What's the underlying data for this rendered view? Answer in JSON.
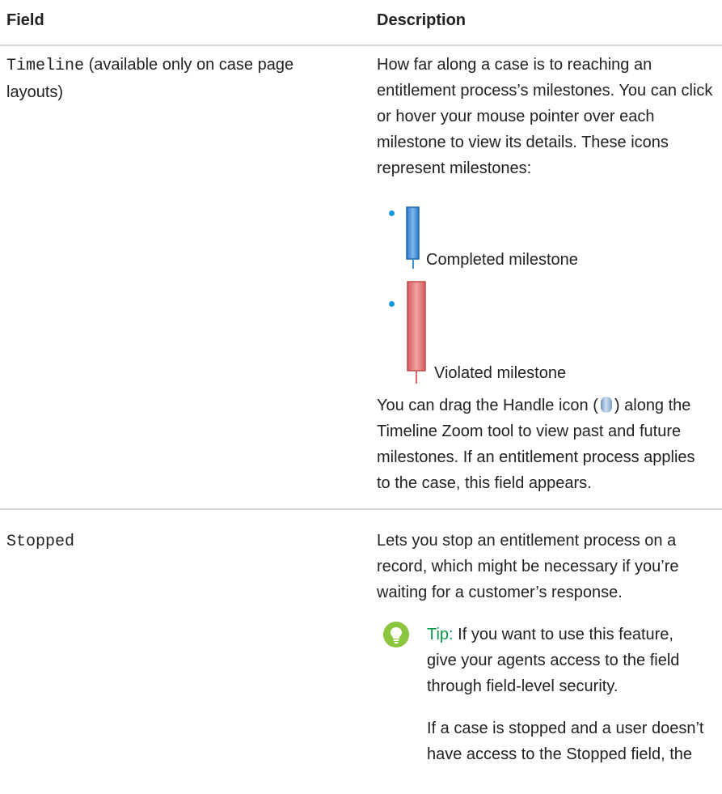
{
  "header": {
    "field": "Field",
    "description": "Description"
  },
  "rows": [
    {
      "field_code": "Timeline",
      "field_note": "(available only on case page layouts)",
      "desc_lines": [
        "How far along a case is to reaching an",
        "entitlement process’s milestones. You can click",
        "or hover your mouse pointer over each",
        "milestone to view its details. These icons",
        "represent milestones:"
      ],
      "bullets": [
        {
          "label": "Completed milestone",
          "color": "#3d8fd6"
        },
        {
          "label": "Violated milestone",
          "color": "#e06666"
        }
      ],
      "after_lines_1": "You can drag the Handle icon (",
      "after_lines_1b": ") along the",
      "after_lines": [
        "Timeline Zoom tool to view past and future",
        "milestones. If an entitlement process applies",
        "to the case, this field appears."
      ]
    },
    {
      "field_code": "Stopped",
      "desc_lines": [
        "Lets you stop an entitlement process on a",
        "record, which might be necessary if you’re",
        "waiting for a customer’s response."
      ],
      "tip_label": "Tip:",
      "tip_lines": [
        " If you want to use this feature,",
        "give your agents access to the field",
        "through field-level security."
      ],
      "tip_more": [
        "If a case is stopped and a user doesn’t",
        "have access to the Stopped field, the"
      ]
    }
  ]
}
